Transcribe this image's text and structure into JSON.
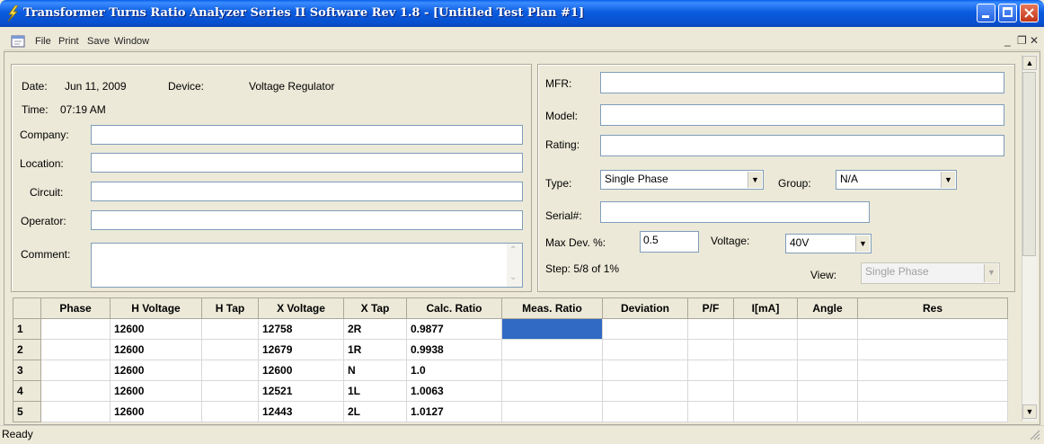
{
  "window": {
    "title": "Transformer Turns Ratio Analyzer Series II Software Rev 1.8 - [Untitled Test Plan #1]"
  },
  "menu": {
    "items": [
      "File",
      "Print",
      "Save",
      "Window"
    ]
  },
  "left_panel": {
    "date_label": "Date:",
    "date_value": "Jun 11, 2009",
    "device_label": "Device:",
    "device_value": "Voltage Regulator",
    "time_label": "Time:",
    "time_value": "07:19 AM",
    "company_label": "Company:",
    "company_value": "",
    "location_label": "Location:",
    "location_value": "",
    "circuit_label": "Circuit:",
    "circuit_value": "",
    "operator_label": "Operator:",
    "operator_value": "",
    "comment_label": "Comment:",
    "comment_value": ""
  },
  "right_panel": {
    "mfr_label": "MFR:",
    "mfr_value": "",
    "model_label": "Model:",
    "model_value": "",
    "rating_label": "Rating:",
    "rating_value": "",
    "type_label": "Type:",
    "type_value": "Single Phase",
    "group_label": "Group:",
    "group_value": "N/A",
    "serial_label": "Serial#:",
    "serial_value": "",
    "maxdev_label": "Max Dev. %:",
    "maxdev_value": "0.5",
    "voltage_label": "Voltage:",
    "voltage_value": "40V",
    "step_text": "Step: 5/8 of 1%",
    "view_label": "View:",
    "view_value": "Single Phase"
  },
  "grid": {
    "columns": [
      "",
      "Phase",
      "H Voltage",
      "H Tap",
      "X Voltage",
      "X Tap",
      "Calc. Ratio",
      "Meas. Ratio",
      "Deviation",
      "P/F",
      "I[mA]",
      "Angle",
      "Res"
    ],
    "rows": [
      [
        "1",
        "",
        "12600",
        "",
        "12758",
        "2R",
        "0.9877",
        "",
        "",
        "",
        "",
        "",
        ""
      ],
      [
        "2",
        "",
        "12600",
        "",
        "12679",
        "1R",
        "0.9938",
        "",
        "",
        "",
        "",
        "",
        ""
      ],
      [
        "3",
        "",
        "12600",
        "",
        "12600",
        "N",
        "1.0",
        "",
        "",
        "",
        "",
        "",
        ""
      ],
      [
        "4",
        "",
        "12600",
        "",
        "12521",
        "1L",
        "1.0063",
        "",
        "",
        "",
        "",
        "",
        ""
      ],
      [
        "5",
        "",
        "12600",
        "",
        "12443",
        "2L",
        "1.0127",
        "",
        "",
        "",
        "",
        "",
        ""
      ]
    ]
  },
  "status": {
    "text": "Ready"
  }
}
